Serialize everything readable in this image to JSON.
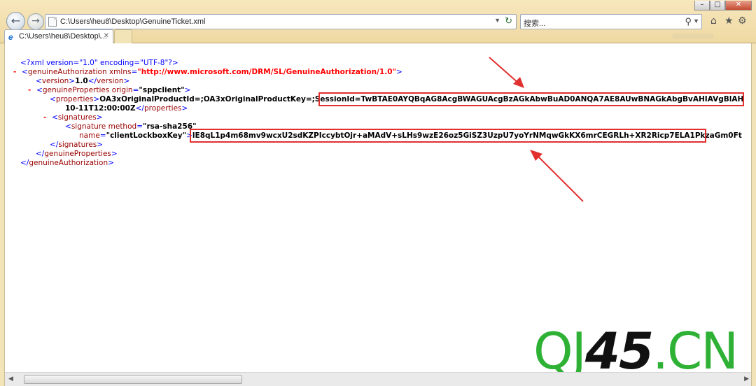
{
  "browser": {
    "address": "C:\\Users\\heu8\\Desktop\\GenuineTicket.xml",
    "search_placeholder": "搜索...",
    "tab_title": "C:\\Users\\heu8\\Desktop\\...",
    "icons": [
      "back-icon",
      "forward-icon",
      "refresh-icon",
      "search-icon",
      "home-icon",
      "favorites-icon",
      "settings-icon",
      "ie-icon",
      "close-icon"
    ]
  },
  "xml": {
    "pi": "<?xml version=\"1.0\" encoding=\"UTF-8\"?>",
    "collapse": "-",
    "root_tag": "genuineAuthorization",
    "root_attr_name": "xmlns",
    "root_attr_value": "\"http://www.microsoft.com/DRM/SL/GenuineAuthorization/1.0\"",
    "version_tag": "version",
    "version_value": "1.0",
    "gp_tag": "genuineProperties",
    "gp_attr_name": "origin",
    "gp_attr_value": "\"sppclient\"",
    "props_tag": "properties",
    "props_text_a": "OA3xOriginalProductId=;OA3xOriginalProductKey=;",
    "props_text_b": "SessionId=TwBTAE0AYQBqAG8AcgBWAGUAcgBzAGkAbwBuAD0ANQA7AE8AUwBNAGkAbgBvAHIAVgBlAH",
    "props_text_c": "10-11T12:00:00Z",
    "sigs_tag": "signatures",
    "sig_tag": "signature",
    "sig_attr1_name": "method",
    "sig_attr1_value": "\"rsa-sha256\"",
    "sig_attr2_name": "name",
    "sig_attr2_value": "\"clientLockboxKey\"",
    "sig_text": "lE8qL1p4m68mv9wcxU2sdKZPIccybtOjr+aMAdV+sLHs9wzE26oz5GiSZ3UzpU7yoYrNMqwGkKX6mrCEGRLh+XR2Ricp7ELA1PkzaGm0Ft"
  },
  "watermark": {
    "part1": "QJ",
    "part2": "45",
    "part3": ".CN"
  },
  "colors": {
    "annotation_red": "#e03030",
    "watermark_green": "#2eb135"
  }
}
